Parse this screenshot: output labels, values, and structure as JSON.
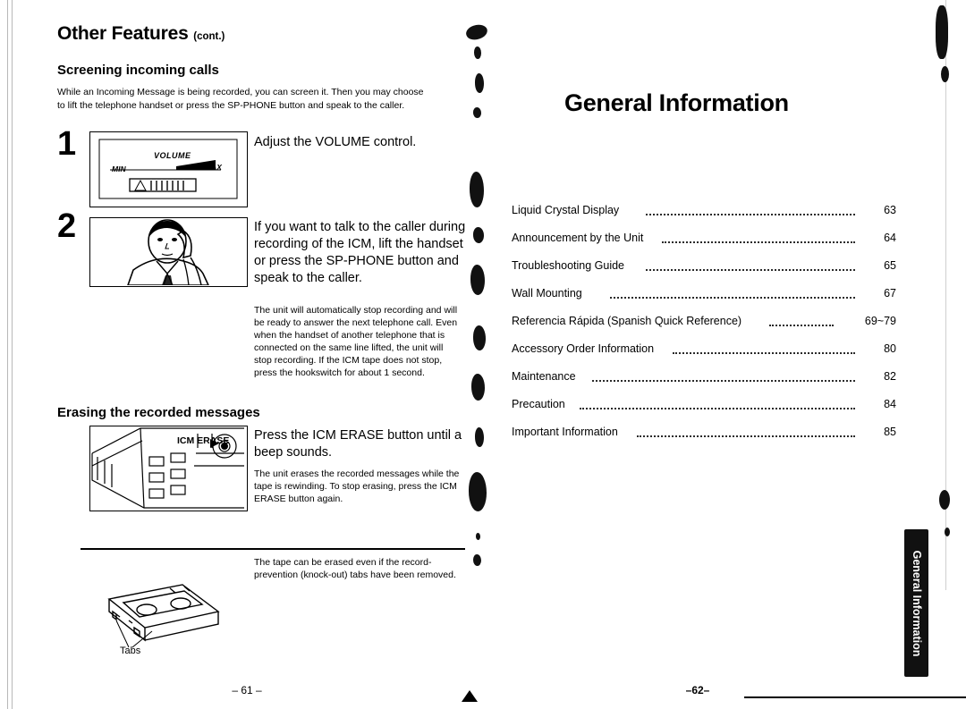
{
  "document": {
    "left_page": {
      "title": "Other Features",
      "title_suffix": "(cont.)",
      "section1_heading": "Screening incoming calls",
      "intro": "While an Incoming Message is being recorded, you can screen it. Then you may choose to lift the telephone handset or press the SP-PHONE button and speak to the caller.",
      "steps": [
        {
          "number": "1",
          "text": "Adjust the VOLUME control."
        },
        {
          "number": "2",
          "text": "If you want to talk to the caller during recording of the ICM, lift the handset or press the SP-PHONE button and speak to the caller.",
          "note": "The unit will automatically stop recording and will be ready to answer the next telephone call. Even when the handset of another telephone that is connected on the same line lifted, the unit will stop recording. If the ICM tape does not stop, press the hookswitch for about 1 second."
        }
      ],
      "section2_heading": "Erasing the recorded messages",
      "erase_instruction": "Press the ICM ERASE button until a beep sounds.",
      "erase_note": "The unit erases the recorded messages while the tape is rewinding. To stop erasing, press the ICM ERASE button again.",
      "tape_note": "The tape can be erased even if the record-prevention (knock-out) tabs have been removed.",
      "tabs_caption": "Tabs",
      "page_number": "– 61 –",
      "illustration_labels": {
        "volume": "VOLUME",
        "min": "MIN",
        "max": "MAX",
        "icm_erase": "ICM ERASE"
      }
    },
    "right_page": {
      "title": "General Information",
      "toc": [
        {
          "label": "Liquid Crystal Display",
          "page": "63"
        },
        {
          "label": "Announcement by the Unit",
          "page": "64"
        },
        {
          "label": "Troubleshooting Guide",
          "page": "65"
        },
        {
          "label": "Wall Mounting",
          "page": "67"
        },
        {
          "label": "Referencia Rápida (Spanish Quick Reference)",
          "page": "69~79"
        },
        {
          "label": "Accessory Order Information",
          "page": "80"
        },
        {
          "label": "Maintenance",
          "page": "82"
        },
        {
          "label": "Precaution",
          "page": "84"
        },
        {
          "label": "Important Information",
          "page": "85"
        }
      ],
      "side_tab": "General Information",
      "page_number": "–62–"
    }
  }
}
